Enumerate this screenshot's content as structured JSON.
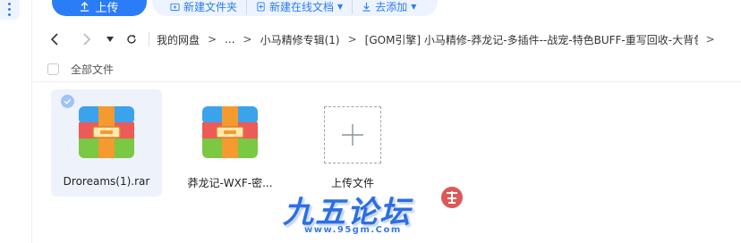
{
  "toolbar": {
    "upload_label": "上传",
    "new_folder_label": "新建文件夹",
    "new_online_doc_label": "新建在线文档",
    "add_label": "去添加"
  },
  "breadcrumb": {
    "items": [
      "我的网盘",
      "...",
      "小马精修专辑(1)",
      "[GOM引擎] 小马精修-莽龙记-多插件--战宠-特色BUFF-重写回收-大背包..."
    ]
  },
  "list": {
    "select_all_label": "全部文件"
  },
  "files": [
    {
      "name": "Droreams(1).rar",
      "selected": true,
      "icon": "rar-archive-icon"
    },
    {
      "name": "莽龙记-WXF-密...",
      "selected": false,
      "icon": "rar-archive-icon"
    }
  ],
  "upload_tile": {
    "label": "上传文件"
  },
  "watermark": {
    "title": "九五论坛",
    "url": "www.95gm.Com"
  },
  "colors": {
    "accent": "#2b7cf7",
    "selected_bg": "#eef2fb"
  }
}
